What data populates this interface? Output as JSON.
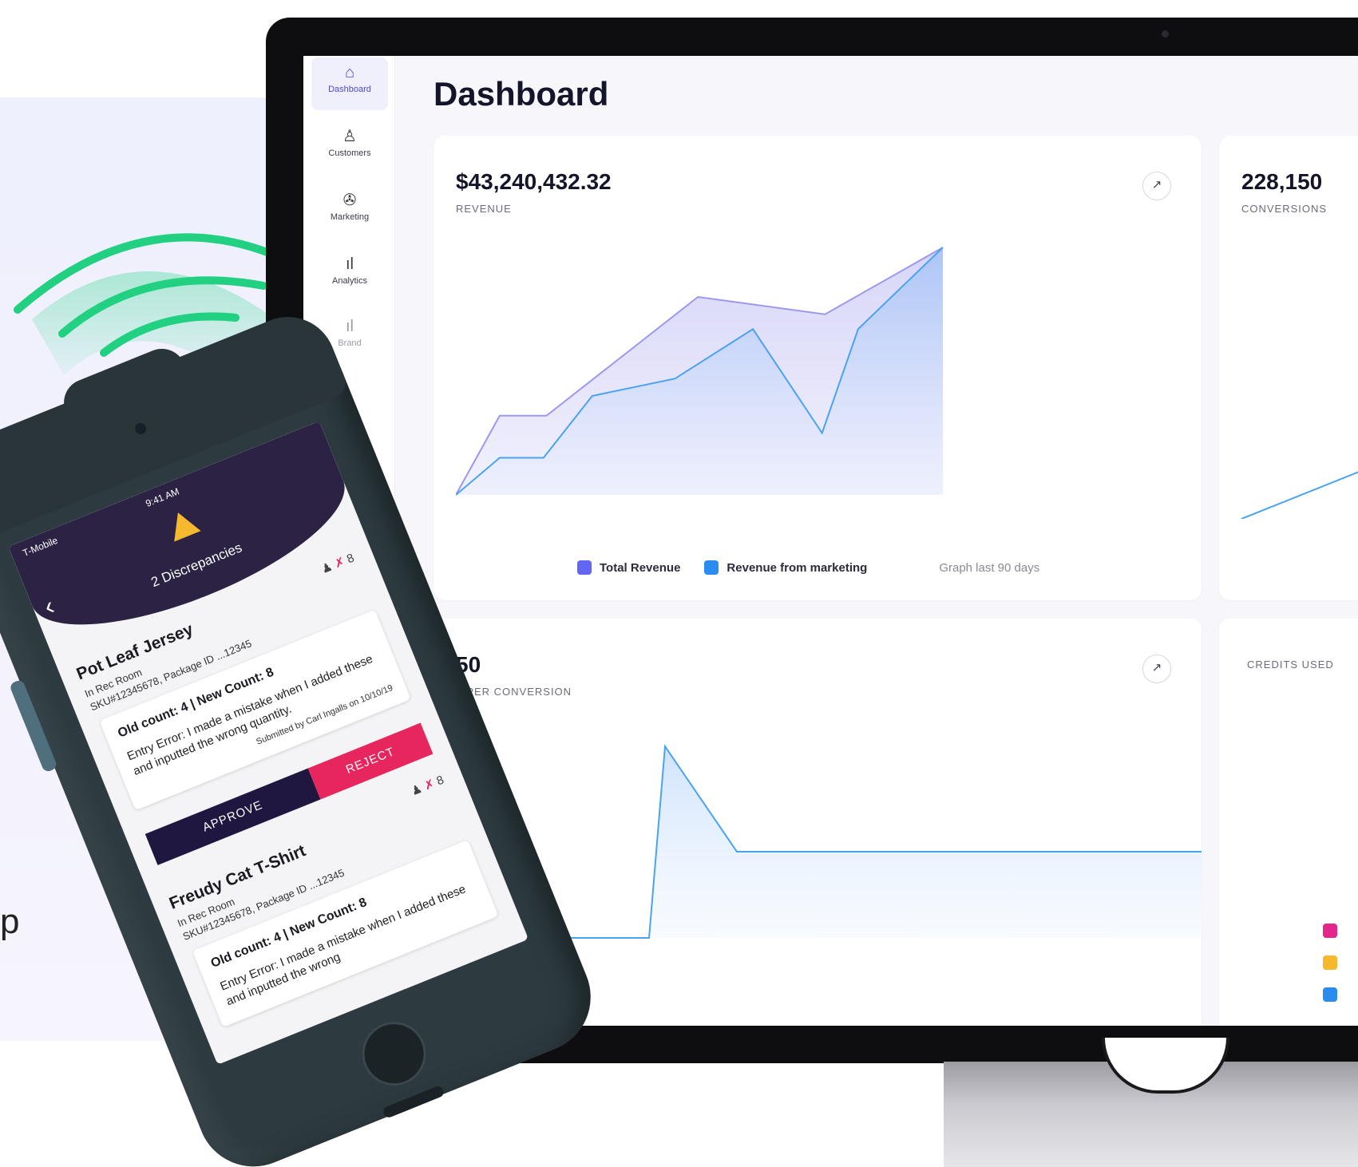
{
  "left_text": "p",
  "sidebar": {
    "items": [
      {
        "label": "Dashboard",
        "icon": "home-icon"
      },
      {
        "label": "Customers",
        "icon": "users-icon"
      },
      {
        "label": "Marketing",
        "icon": "megaphone-icon"
      },
      {
        "label": "Analytics",
        "icon": "bar-chart-icon"
      },
      {
        "label": "Brand",
        "icon": "bar-chart-icon"
      }
    ]
  },
  "page": {
    "title": "Dashboard"
  },
  "revenue_card": {
    "value": "$43,240,432.32",
    "label": "REVENUE",
    "expand": "↗",
    "legend": [
      {
        "label": "Total Revenue",
        "color": "#6366f1"
      },
      {
        "label": "Revenue from marketing",
        "color": "#2b8cf0"
      }
    ],
    "note": "Graph last 90 days"
  },
  "conversions_card": {
    "value": "228,150",
    "label": "CONVERSIONS"
  },
  "cost_card": {
    "value": "50",
    "label": "T PER CONVERSION",
    "expand": "↗"
  },
  "credits_card": {
    "label": "CREDITS USED",
    "legend_colors": [
      "#e3268c",
      "#f5b82e",
      "#2b8cf0"
    ]
  },
  "chart_data": [
    {
      "type": "area",
      "series": [
        {
          "name": "Total Revenue",
          "values": [
            0,
            32,
            32,
            55,
            80,
            76,
            73,
            100
          ]
        },
        {
          "name": "Revenue from marketing",
          "values": [
            0,
            15,
            15,
            40,
            47,
            67,
            25,
            67,
            100
          ]
        }
      ]
    },
    {
      "type": "line",
      "values": [
        0,
        40
      ]
    },
    {
      "type": "area",
      "values": [
        0,
        0,
        100,
        45,
        45,
        45,
        45,
        45
      ]
    }
  ],
  "phone": {
    "carrier": "T-Mobile",
    "time": "9:41 AM",
    "back": "‹",
    "title": "2 Discrepancies",
    "items": [
      {
        "name": "Pot Leaf Jersey",
        "location": "In Rec Room",
        "sku": "SKU#12345678, Package ID ...12345",
        "badge_count": "8",
        "counts": "Old count: 4 | New Count: 8",
        "error": "Entry Error: I made a mistake when I added these and inputted the wrong quantity.",
        "submitted": "Submitted by Carl Ingalls on 10/10/19",
        "approve": "APPROVE",
        "reject": "REJECT"
      },
      {
        "name": "Freudy Cat T-Shirt",
        "location": "In Rec Room",
        "sku": "SKU#12345678, Package ID ...12345",
        "badge_count": "8",
        "counts": "Old count: 4 | New Count: 8",
        "error": "Entry Error: I made a mistake when I added these and inputted the wrong"
      }
    ]
  }
}
